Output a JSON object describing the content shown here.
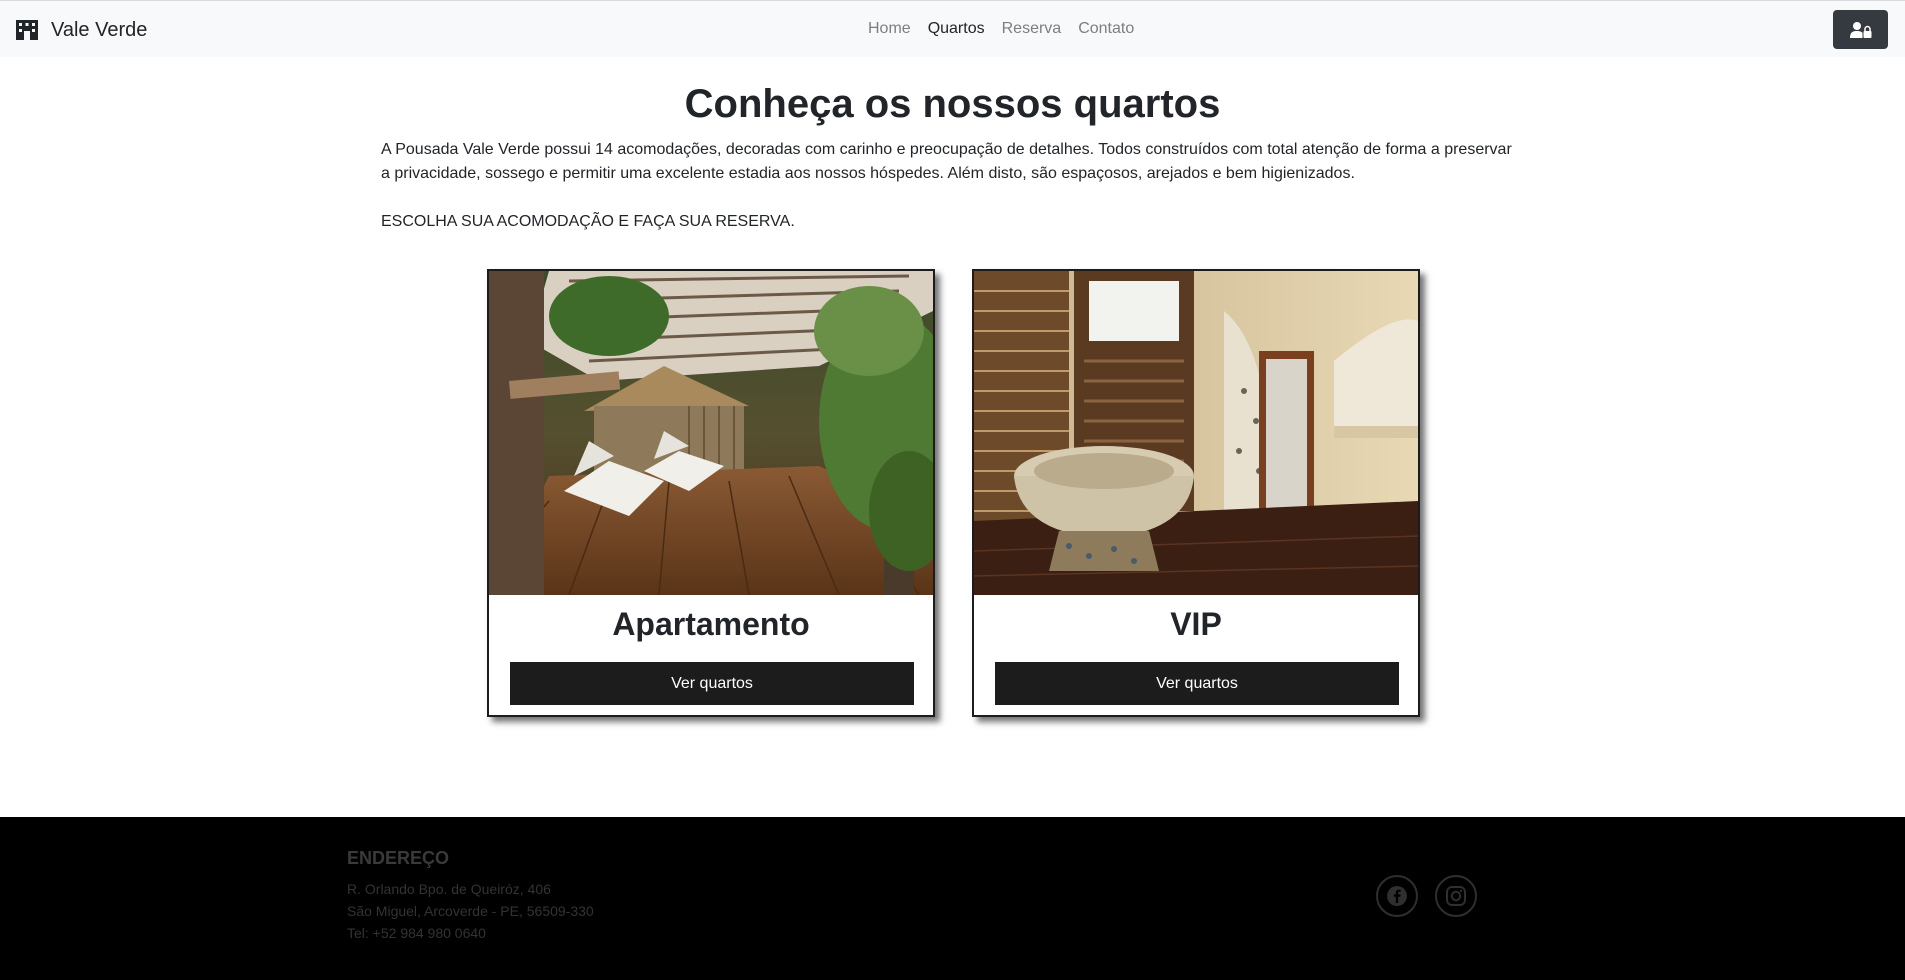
{
  "navbar": {
    "brand": "Vale Verde",
    "links": [
      {
        "label": "Home",
        "active": false
      },
      {
        "label": "Quartos",
        "active": true
      },
      {
        "label": "Reserva",
        "active": false
      },
      {
        "label": "Contato",
        "active": false
      }
    ],
    "login_icon": "user-lock-icon"
  },
  "main": {
    "title": "Conheça os nossos quartos",
    "description": "A Pousada Vale Verde possui 14 acomodações, decoradas com carinho e preocupação de detalhes. Todos construídos com total atenção de forma a preservar a privacidade, sossego e permitir uma excelente estadia aos nossos hóspedes. Além disto, são espaçosos, arejados e bem higienizados.",
    "cta": "ESCOLHA SUA ACOMODAÇÃO E FAÇA SUA RESERVA.",
    "cards": [
      {
        "title": "Apartamento",
        "button": "Ver quartos"
      },
      {
        "title": "VIP",
        "button": "Ver quartos"
      }
    ]
  },
  "footer": {
    "heading": "ENDEREÇO",
    "address_line1": "R. Orlando Bpo. de Queiróz, 406",
    "address_line2": "São Miguel, Arcoverde - PE, 56509-330",
    "phone": "Tel: +52 984 980 0640",
    "social": [
      "facebook-icon",
      "instagram-icon"
    ]
  },
  "colors": {
    "navbar_bg": "#f8f9fa",
    "button_dark": "#1c1c1c",
    "footer_bg": "#000000"
  }
}
